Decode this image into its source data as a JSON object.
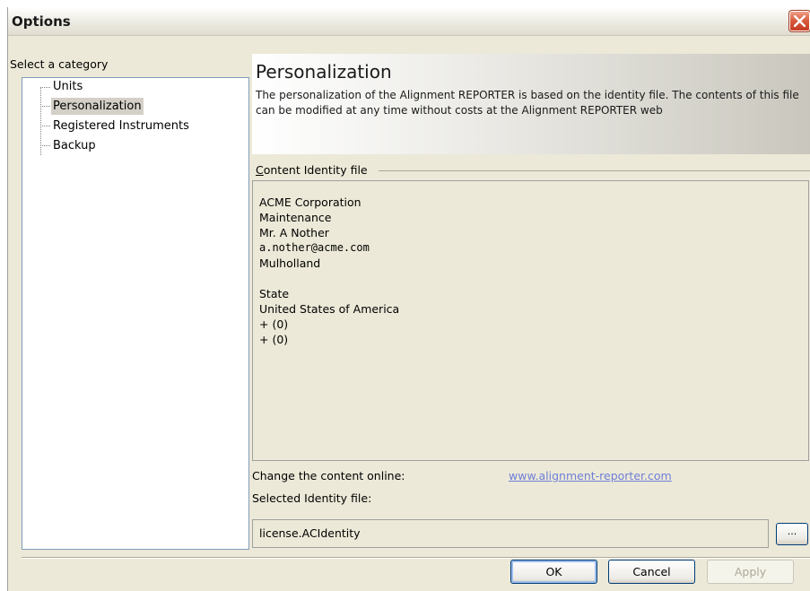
{
  "window": {
    "title": "Options"
  },
  "category": {
    "label": "Select a category",
    "items": [
      "Units",
      "Personalization",
      "Registered Instruments",
      "Backup"
    ],
    "selected": "Personalization"
  },
  "header": {
    "title": "Personalization",
    "description": "The personalization of the Alignment REPORTER is based on the identity file. The contents of this file can be modified at any time without costs at the Alignment REPORTER web"
  },
  "content_group": {
    "label_mnemonic": "C",
    "label_rest": "ontent Identity file",
    "lines": [
      "ACME Corporation",
      "Maintenance",
      "Mr. A Nother",
      "a.nother@acme.com",
      "Mulholland",
      "",
      "State",
      "United States of America",
      "+ (0)",
      "+ (0)"
    ]
  },
  "online": {
    "label": "Change the content online:",
    "link": "www.alignment-reporter.com"
  },
  "selected_file": {
    "label": "Selected Identity file:",
    "value": "license.ACIdentity",
    "browse_label": "..."
  },
  "buttons": {
    "ok": "OK",
    "cancel": "Cancel",
    "apply": "Apply"
  }
}
